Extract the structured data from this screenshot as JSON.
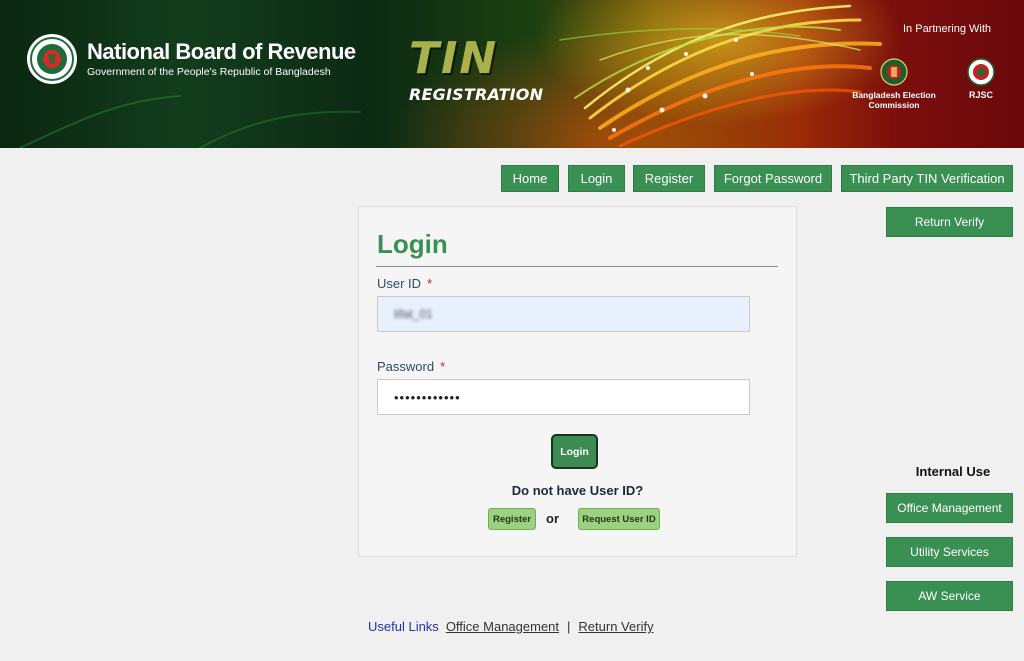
{
  "banner": {
    "org_title": "National Board of Revenue",
    "org_subtitle": "Government of the People's Republic of Bangladesh",
    "app_title": "TIN",
    "app_subtitle": "REGISTRATION",
    "partnering_text": "In Partnering With",
    "partners": [
      {
        "label": "Bangladesh Election Commission",
        "icon": "election-commission-emblem"
      },
      {
        "label": "RJSC",
        "icon": "rjsc-emblem"
      }
    ],
    "logo_icon": "nbr-seal-icon"
  },
  "nav": {
    "items": [
      "Home",
      "Login",
      "Register",
      "Forgot Password",
      "Third Party TIN Verification"
    ]
  },
  "side": {
    "return_verify": "Return Verify",
    "internal_use_heading": "Internal Use",
    "internal_items": [
      "Office Management",
      "Utility Services",
      "AW Service"
    ]
  },
  "login": {
    "title": "Login",
    "user_id_label": "User ID",
    "user_id_value": "lifat_01",
    "password_label": "Password",
    "password_value": "••••••••••••",
    "required_marker": "*",
    "submit_label": "Login",
    "no_user_text": "Do not have User ID?",
    "register_label": "Register",
    "or_text": "or",
    "request_label": "Request User ID"
  },
  "footer": {
    "useful_links_label": "Useful Links",
    "links": [
      "Office Management",
      "Return Verify"
    ],
    "separator": "|"
  },
  "colors": {
    "brand_green": "#3a8f53",
    "title_green": "#3a8f53",
    "light_green": "#9ed081",
    "required_red": "#d21d1d",
    "link_blue": "#2133a8"
  }
}
